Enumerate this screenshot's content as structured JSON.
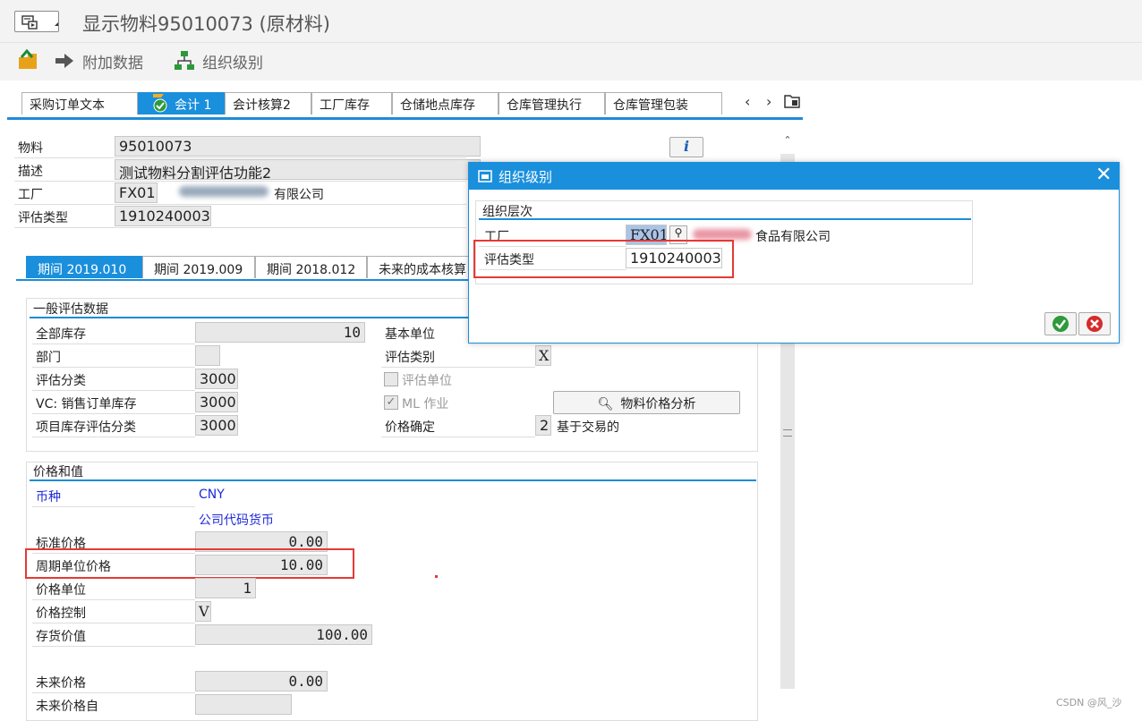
{
  "title": "显示物料95010073 (原材料)",
  "toolbar": {
    "additional_data": "附加数据",
    "org_levels": "组织级别"
  },
  "tabs": [
    "采购订单文本",
    "会计 1",
    "会计核算2",
    "工厂库存",
    "仓储地点库存",
    "仓库管理执行",
    "仓库管理包装"
  ],
  "header": {
    "material_label": "物料",
    "material_value": "95010073",
    "desc_label": "描述",
    "desc_value": "测试物料分割评估功能2",
    "plant_label": "工厂",
    "plant_value": "FX01",
    "plant_name_suffix": "有限公司",
    "valtype_label": "评估类型",
    "valtype_value": "1910240003",
    "info_icon": "i"
  },
  "period_tabs": [
    "期间 2019.010",
    "期间 2019.009",
    "期间 2018.012",
    "未来的成本核算"
  ],
  "general": {
    "title": "一般评估数据",
    "total_stock_label": "全部库存",
    "total_stock_value": "10",
    "division_label": "部门",
    "division_value": "",
    "valclass_label": "评估分类",
    "valclass_value": "3000",
    "vc_label": "VC: 销售订单库存",
    "vc_value": "3000",
    "proj_label": "项目库存评估分类",
    "proj_value": "3000",
    "base_unit_label": "基本单位",
    "valcat_label": "评估类别",
    "valcat_value": "X",
    "val_unit_label": "评估单位",
    "ml_label": "ML 作业",
    "price_analysis_button": "物料价格分析",
    "price_det_label": "价格确定",
    "price_det_value": "2",
    "price_det_text": "基于交易的"
  },
  "prices": {
    "title": "价格和值",
    "currency_label": "币种",
    "currency_value": "CNY",
    "company_currency": "公司代码货币",
    "std_price_label": "标准价格",
    "std_price_value": "0.00",
    "periodic_price_label": "周期单位价格",
    "periodic_price_value": "10.00",
    "price_unit_label": "价格单位",
    "price_unit_value": "1",
    "price_ctrl_label": "价格控制",
    "price_ctrl_value": "V",
    "stock_value_label": "存货价值",
    "stock_value_value": "100.00",
    "future_price_label": "未来价格",
    "future_price_value": "0.00",
    "future_from_label": "未来价格自",
    "future_from_value": ""
  },
  "popup": {
    "title": "组织级别",
    "section": "组织层次",
    "plant_label": "工厂",
    "plant_value": "FX01",
    "plant_name_suffix": "食品有限公司",
    "valtype_label": "评估类型",
    "valtype_value": "1910240003"
  },
  "watermark": "CSDN @风_沙",
  "colors": {
    "accent": "#1a8fdc",
    "highlight": "#e53935",
    "link": "#1d2ad8"
  }
}
